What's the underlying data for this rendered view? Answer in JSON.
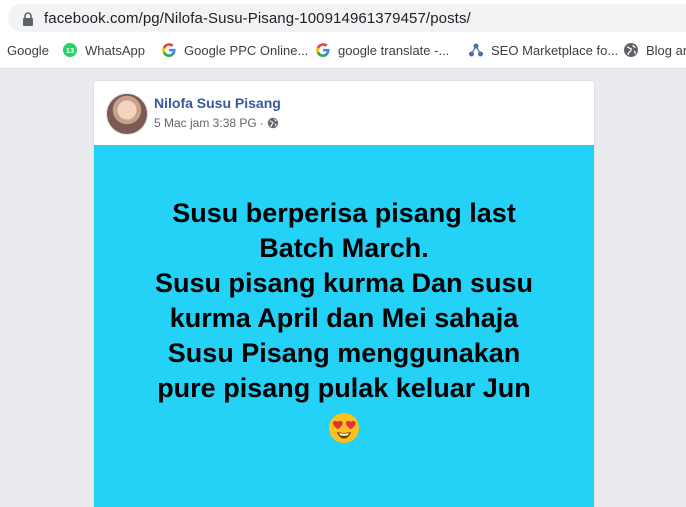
{
  "browser": {
    "url": "facebook.com/pg/Nilofa-Susu-Pisang-100914961379457/posts/",
    "bookmarks": [
      {
        "label": "Google",
        "icon": "none"
      },
      {
        "label": "WhatsApp",
        "icon": "whatsapp-icon"
      },
      {
        "label": "Google PPC Online...",
        "icon": "google-icon"
      },
      {
        "label": "google translate -...",
        "icon": "google-icon"
      },
      {
        "label": "SEO Marketplace fo...",
        "icon": "network-icon"
      },
      {
        "label": "Blog an",
        "icon": "globe-icon"
      }
    ]
  },
  "post": {
    "page_name": "Nilofa Susu Pisang",
    "timestamp": "5 Mac jam 3:38 PG",
    "separator": "·",
    "privacy_icon": "globe-icon",
    "image_lines": [
      "Susu berperisa pisang last",
      "Batch March.",
      "Susu pisang kurma Dan susu",
      "kurma April dan Mei sahaja",
      "Susu Pisang menggunakan",
      "pure pisang pulak keluar Jun"
    ],
    "emoji": "heart-eyes-emoji"
  },
  "colors": {
    "image_background": "#24d1f7",
    "page_name": "#385898",
    "page_background": "#e9ebee"
  }
}
